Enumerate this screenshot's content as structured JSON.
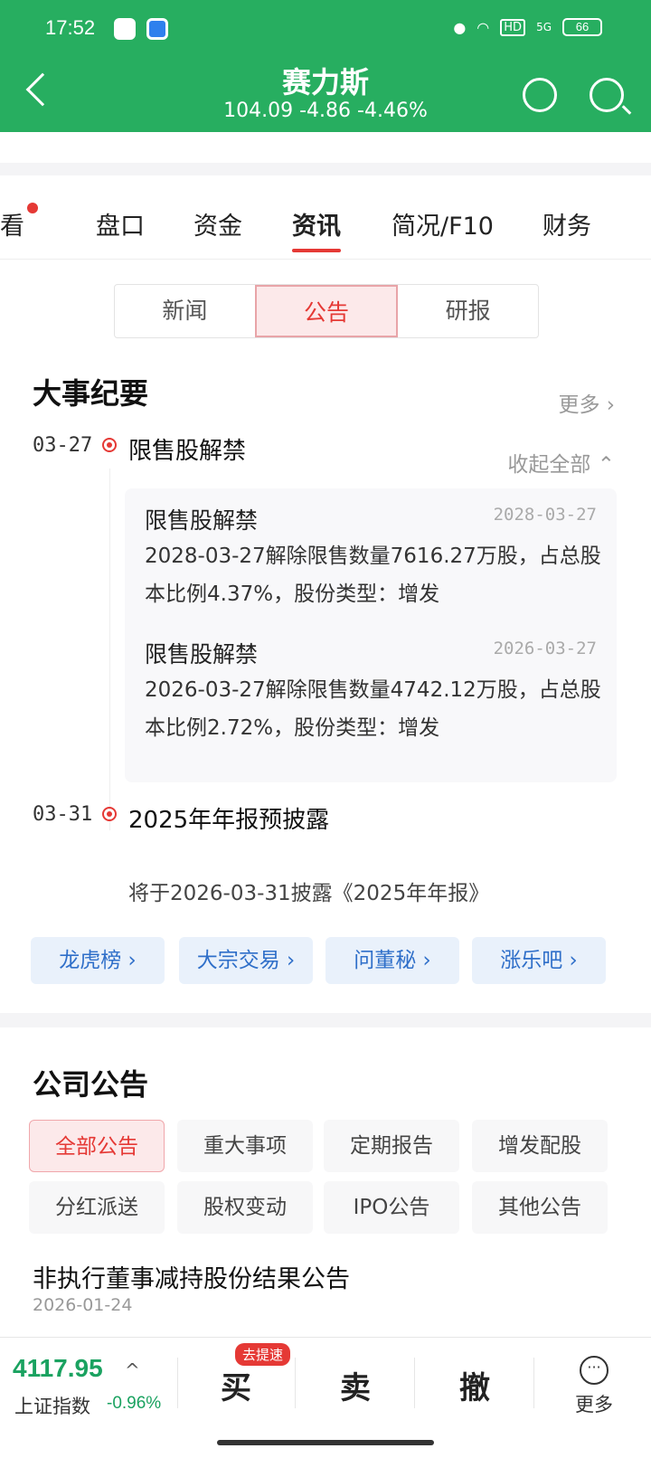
{
  "status_bar": {
    "time": "17:52",
    "battery": "66",
    "network": "5G",
    "hd": "HD"
  },
  "header": {
    "name": "赛力斯",
    "price_line": "104.09 -4.86 -4.46%"
  },
  "tabs": [
    {
      "label": "看"
    },
    {
      "label": "盘口"
    },
    {
      "label": "资金"
    },
    {
      "label": "资讯"
    },
    {
      "label": "简况/F10"
    },
    {
      "label": "财务"
    }
  ],
  "segment": [
    "新闻",
    "公告",
    "研报"
  ],
  "events_section": {
    "title": "大事纪要",
    "more": "更多 ›",
    "collapse": "收起全部 ⌃",
    "events": [
      {
        "date": "03-27",
        "title": "限售股解禁",
        "details": [
          {
            "title": "限售股解禁",
            "date": "2028-03-27",
            "body": "2028-03-27解除限售数量7616.27万股，占总股本比例4.37%，股份类型：增发"
          },
          {
            "title": "限售股解禁",
            "date": "2026-03-27",
            "body": "2026-03-27解除限售数量4742.12万股，占总股本比例2.72%，股份类型：增发"
          }
        ]
      },
      {
        "date": "03-31",
        "title": "2025年年报预披露",
        "sub": "将于2026-03-31披露《2025年年报》"
      }
    ]
  },
  "quick_links": [
    "龙虎榜 ›",
    "大宗交易 ›",
    "问董秘 ›",
    "涨乐吧 ›"
  ],
  "company_notices": {
    "title": "公司公告",
    "filters": [
      "全部公告",
      "重大事项",
      "定期报告",
      "增发配股",
      "分红派送",
      "股权变动",
      "IPO公告",
      "其他公告"
    ],
    "items": [
      {
        "title": "非执行董事减持股份结果公告",
        "date": "2026-01-24"
      }
    ]
  },
  "bottom_bar": {
    "index_value": "4117.95",
    "index_arrow": "^",
    "index_name": "上证指数",
    "index_pct": "-0.96%",
    "buy": "买",
    "buy_badge": "去提速",
    "sell": "卖",
    "cancel": "撤",
    "more": "更多",
    "more_glyph": "···"
  },
  "colors": {
    "brand_green": "#27ae60",
    "accent_red": "#e53935",
    "link_blue": "#2f6fc9",
    "down_green": "#1aa260"
  }
}
